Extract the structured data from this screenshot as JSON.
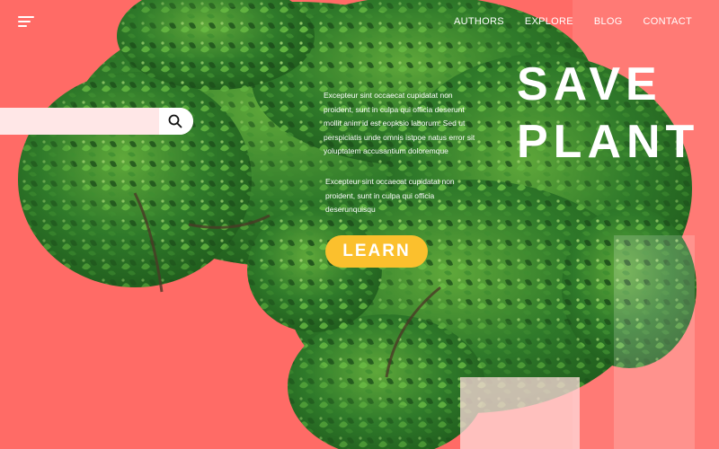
{
  "nav": {
    "items": [
      "AUTHORS",
      "EXPLORE",
      "BLOG",
      "CONTACT"
    ]
  },
  "hero": {
    "title_line1": "SAVE",
    "title_line2": "PLANT",
    "paragraph1": "Excepteur sint occaecat cupidatat non proident, sunt in culpa qui officia deserunt mollit anim id est eopksio laborum. Sed ut perspiciatis unde omnis istpoe natus error sit yoluptatem accusantium doloremque",
    "paragraph2": "Excepteur sint occaecat cupidatat non proident, sunt in culpa qui officia deserunquisqu",
    "cta_label": "LEARN"
  },
  "icons": {
    "menu": "hamburger-menu-icon",
    "search": "search-icon"
  },
  "colors": {
    "background": "#ff6b66",
    "foliage_dark": "#1f5a1c",
    "foliage_mid": "#2f7a2a",
    "foliage_light": "#5fa83a",
    "cta": "#fbc02d",
    "text": "#ffffff"
  }
}
